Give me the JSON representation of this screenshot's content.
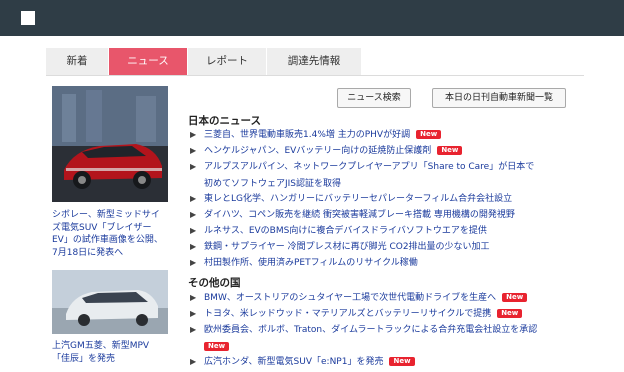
{
  "tabs": [
    {
      "label": "新着"
    },
    {
      "label": "ニュース"
    },
    {
      "label": "レポート"
    },
    {
      "label": "調達先情報"
    }
  ],
  "buttons": {
    "news_search": "ニュース検索",
    "today_paper": "本日の日刊自動車新聞一覧"
  },
  "side": [
    {
      "caption_lines": [
        "シボレー、新型ミッドサイ",
        "ズ電気SUV「ブレイザー",
        "EV」の試作車画像を公開、",
        "7月18日に発表へ"
      ]
    },
    {
      "caption_lines": [
        "上汽GM五菱、新型MPV",
        "「佳辰」を発売"
      ]
    }
  ],
  "domestic": {
    "heading": "日本のニュース",
    "items": [
      {
        "text": "三菱自、世界電動車販売1.4%増 主力のPHVが好調",
        "badge": "New"
      },
      {
        "text": "ヘンケルジャパン、EVバッテリー向けの延焼防止保護剤",
        "badge": "New"
      },
      {
        "text": "アルプスアルパイン、ネットワークプレイヤーアプリ「Share to Care」が日本で",
        "text2": "初めてソフトウェアJIS認証を取得"
      },
      {
        "text": "東レとLG化学、ハンガリーにバッテリーセパレーターフィルム合弁会社設立"
      },
      {
        "text": "ダイハツ、コペン販売を継続 衝突被害軽減ブレーキ搭載 専用機構の開発視野"
      },
      {
        "text": "ルネサス、EVのBMS向けに複合デバイスドライバソフトウエアを提供"
      },
      {
        "text": "鉄鋼・サプライヤー 冷間プレス材に再び脚光 CO2排出量の少ない加工"
      },
      {
        "text": "村田製作所、使用済みPETフィルムのリサイクル稼働"
      }
    ]
  },
  "foreign": {
    "heading": "その他の国",
    "items": [
      {
        "text": "BMW、オーストリアのシュタイヤー工場で次世代電動ドライブを生産へ",
        "badge": "New"
      },
      {
        "text": "トヨタ、米レッドウッド・マテリアルズとバッテリーリサイクルで提携",
        "badge": "New"
      },
      {
        "text": "欧州委員会、ボルボ、Traton、ダイムラートラックによる合弁充電会社設立を承認",
        "badge2": "New"
      },
      {
        "text": "広汽ホンダ、新型電気SUV「e:NP1」を発売",
        "badge": "New"
      }
    ]
  },
  "colors": {
    "topbar": "#2f3d46",
    "accent": "#e8566b",
    "link": "#1a3a9c",
    "new_badge": "#e8232f"
  }
}
